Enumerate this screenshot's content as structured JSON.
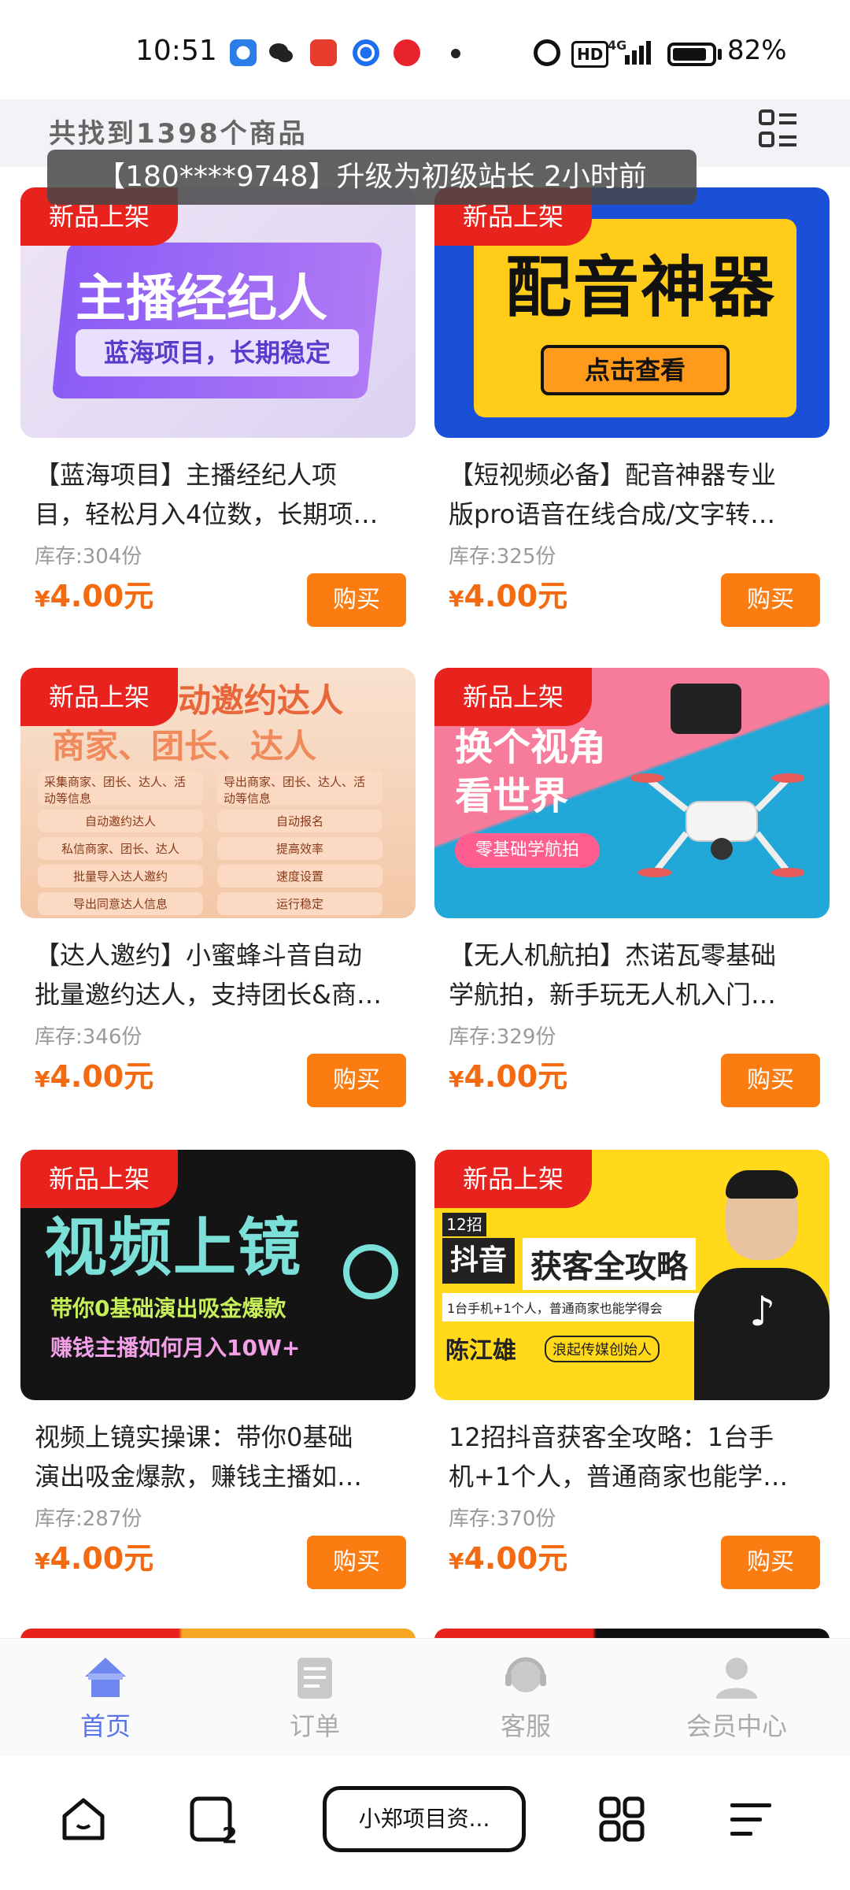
{
  "status_bar": {
    "time": "10:51",
    "battery": "82%",
    "network": "4G",
    "hd": "HD"
  },
  "header": {
    "summary": "共找到1398个商品",
    "grid_toggle_icon": "list-grid-icon"
  },
  "toast": {
    "text": "【180****9748】升级为初级站长 2小时前"
  },
  "products": [
    {
      "badge": "新品上架",
      "thumb_title": "主播经纪人",
      "thumb_sub": "蓝海项目，长期稳定",
      "title_line1": "【蓝海项目】主播经纪人项",
      "title_line2": "目，轻松月入4位数，长期项…",
      "stock": "库存:304份",
      "price_symbol": "¥",
      "price": "4.00元",
      "buy": "购买"
    },
    {
      "badge": "新品上架",
      "thumb_title": "配音神器",
      "thumb_sub": "点击查看",
      "title_line1": "【短视频必备】配音神器专业",
      "title_line2": "版pro语音在线合成/文字转…",
      "stock": "库存:325份",
      "price_symbol": "¥",
      "price": "4.00元",
      "buy": "购买"
    },
    {
      "badge": "新品上架",
      "thumb_title": "动邀约达人",
      "thumb_sub": "商家、团长、达人",
      "thumb_list_left": [
        "采集商家、团长、达人、活动等信息",
        "自动邀约达人",
        "私信商家、团长、达人",
        "批量导入达人邀约",
        "导出同意达人信息"
      ],
      "thumb_list_right": [
        "导出商家、团长、达人、活动等信息",
        "自动报名",
        "提高效率",
        "速度设置",
        "运行稳定"
      ],
      "title_line1": "【达人邀约】小蜜蜂斗音自动",
      "title_line2": "批量邀约达人，支持团长&商…",
      "stock": "库存:346份",
      "price_symbol": "¥",
      "price": "4.00元",
      "buy": "购买"
    },
    {
      "badge": "新品上架",
      "thumb_title": "换个视角看世界",
      "thumb_sub": "零基础学航拍",
      "title_line1": "【无人机航拍】杰诺瓦零基础",
      "title_line2": "学航拍，新手玩无人机入门…",
      "stock": "库存:329份",
      "price_symbol": "¥",
      "price": "4.00元",
      "buy": "购买"
    },
    {
      "badge": "新品上架",
      "thumb_title": "视频上镜",
      "thumb_sub": "带你0基础演出吸金爆款",
      "thumb_sub2": "赚钱主播如何月入10W+",
      "title_line1": "视频上镜实操课：带你0基础",
      "title_line2": "演出吸金爆款，赚钱主播如…",
      "stock": "库存:287份",
      "price_symbol": "¥",
      "price": "4.00元",
      "buy": "购买"
    },
    {
      "badge": "新品上架",
      "thumb_title": "获客全攻略",
      "thumb_tag": "抖音",
      "thumb_num": "12招",
      "thumb_sub": "1台手机+1个人，普通商家也能学得会",
      "thumb_name": "陈江雄",
      "thumb_role": "浪起传媒创始人",
      "title_line1": "12招抖音获客全攻略：1台手",
      "title_line2": "机+1个人，普通商家也能学…",
      "stock": "库存:370份",
      "price_symbol": "¥",
      "price": "4.00元",
      "buy": "购买"
    }
  ],
  "tabbar": {
    "items": [
      {
        "label": "首页",
        "icon": "home-icon",
        "active": true
      },
      {
        "label": "订单",
        "icon": "order-icon",
        "active": false
      },
      {
        "label": "客服",
        "icon": "customer-service-icon",
        "active": false
      },
      {
        "label": "会员中心",
        "icon": "member-icon",
        "active": false
      }
    ]
  },
  "system_nav": {
    "app_pill": "小郑项目资..."
  },
  "colors": {
    "accent_orange": "#fb7d12",
    "price_orange": "#f36a10",
    "badge_red": "#e8231e",
    "tab_active": "#5a74e8"
  }
}
